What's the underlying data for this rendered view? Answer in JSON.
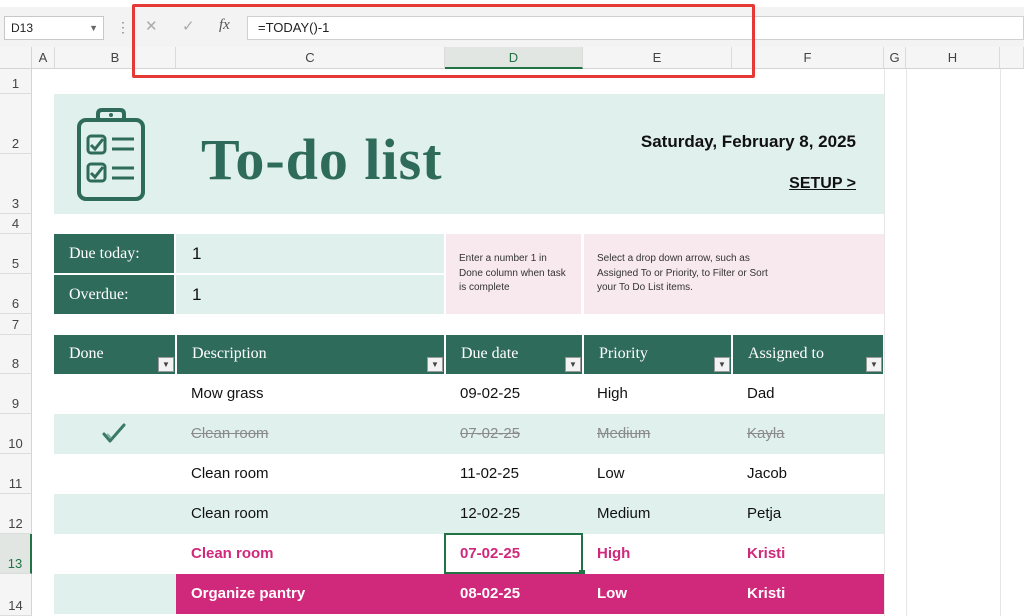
{
  "formula_bar": {
    "name_box": "D13",
    "cancel_icon": "x-icon",
    "enter_icon": "check-icon",
    "fx_label": "fx",
    "formula": "=TODAY()-1"
  },
  "columns": [
    "A",
    "B",
    "C",
    "D",
    "E",
    "F",
    "G",
    "H"
  ],
  "selected_column": "D",
  "rows": [
    "1",
    "2",
    "3",
    "4",
    "5",
    "6",
    "7",
    "8",
    "9",
    "10",
    "11",
    "12",
    "13",
    "14"
  ],
  "selected_row": "13",
  "banner": {
    "title": "To-do list",
    "date": "Saturday, February 8, 2025",
    "setup_link": "SETUP >",
    "icon": "clipboard-checklist-icon"
  },
  "summary": {
    "due_today_label": "Due today:",
    "due_today_value": "1",
    "overdue_label": "Overdue:",
    "overdue_value": "1",
    "tip1": "Enter a number 1 in Done column when task is complete",
    "tip2": "Select a drop down arrow, such as Assigned To or Priority, to Filter or Sort your To Do List items."
  },
  "table": {
    "headers": [
      "Done",
      "Description",
      "Due date",
      "Priority",
      "Assigned to"
    ],
    "rows": [
      {
        "done": "",
        "description": "Mow grass",
        "due": "09-02-25",
        "priority": "High",
        "assigned": "Dad"
      },
      {
        "done": "check",
        "description": "Clean room",
        "due": "07-02-25",
        "priority": "Medium",
        "assigned": "Kayla"
      },
      {
        "done": "",
        "description": "Clean room",
        "due": "11-02-25",
        "priority": "Low",
        "assigned": "Jacob"
      },
      {
        "done": "",
        "description": "Clean room",
        "due": "12-02-25",
        "priority": "Medium",
        "assigned": "Petja"
      },
      {
        "done": "",
        "description": "Clean room",
        "due": "07-02-25",
        "priority": "High",
        "assigned": "Kristi"
      },
      {
        "done": "",
        "description": "Organize pantry",
        "due": "08-02-25",
        "priority": "Low",
        "assigned": "Kristi"
      }
    ]
  },
  "colors": {
    "accent_green": "#2f6b5b",
    "light_green": "#e0f0ec",
    "overdue_pink": "#d0287a",
    "tip_pink": "#f8e9ee",
    "excel_green": "#217346"
  }
}
